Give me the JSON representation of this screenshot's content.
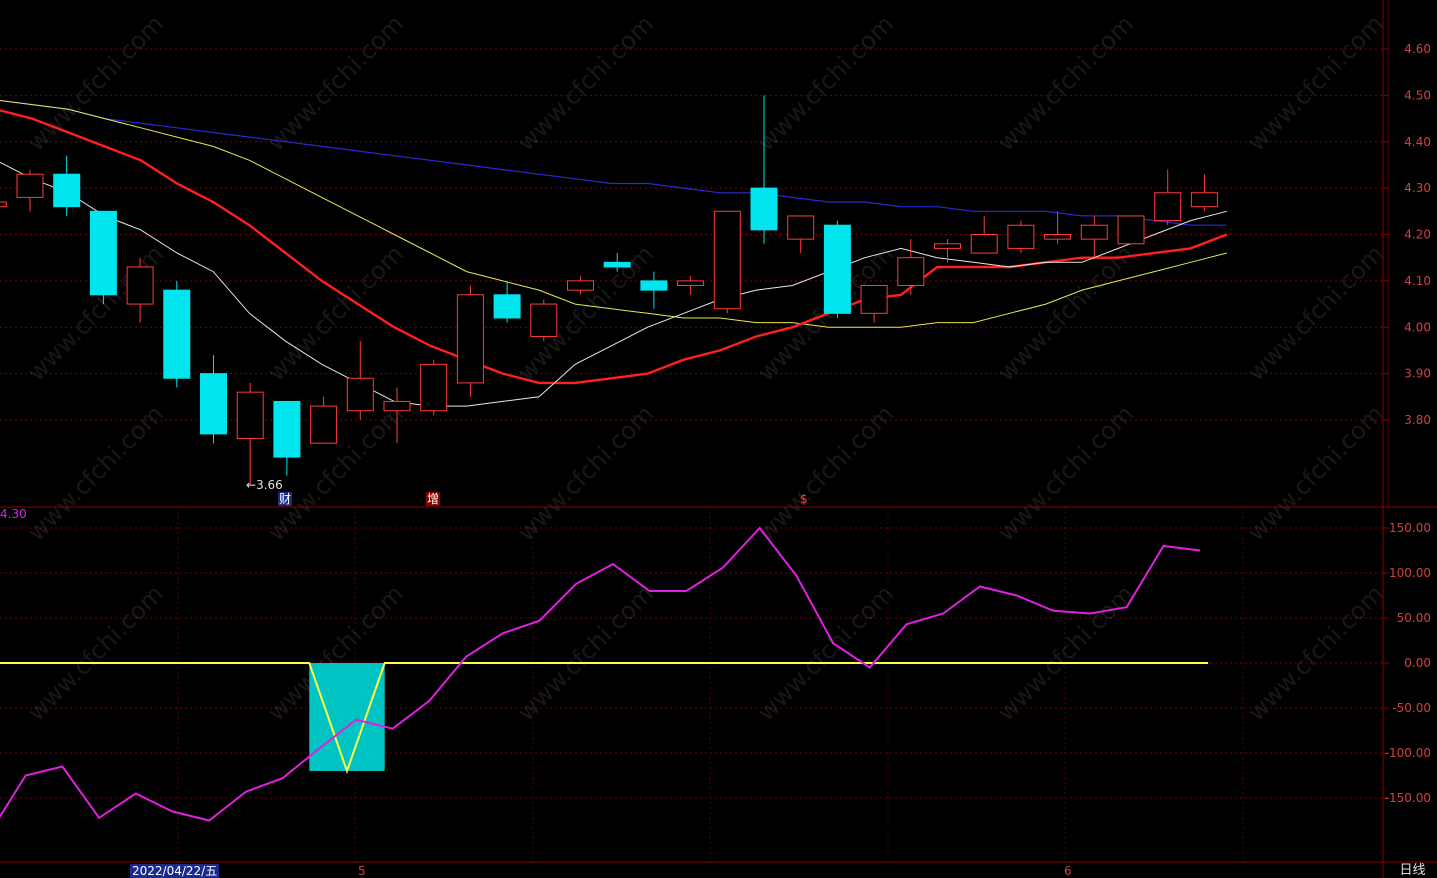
{
  "colors": {
    "background": "#000000",
    "up_candle": "#ff3a3a",
    "down_candle": "#00e5ee",
    "ma5": "#e8e8e8",
    "ma10": "#ff1f1f",
    "ma20": "#e8e850",
    "ma60": "#2a2ad0",
    "indicator_line": "#e020e0",
    "signal_line": "#ffff40",
    "signal_fill": "#00c4c4",
    "axis": "#8b0000",
    "axis_text": "#d04040"
  },
  "price_axis": {
    "ticks": [
      "4.60",
      "4.50",
      "4.40",
      "4.30",
      "4.20",
      "4.10",
      "4.00",
      "3.90",
      "3.80"
    ],
    "range": [
      3.7,
      4.7
    ]
  },
  "indicator_axis": {
    "ticks": [
      "150.00",
      "100.00",
      "50.00",
      "0.00",
      "-50.00",
      "-100.00",
      "-150.00"
    ],
    "range": [
      -190,
      160
    ]
  },
  "indicator_current_value": "4.30",
  "low_marker": "3.66",
  "event_markers": [
    {
      "label": "财",
      "color": "#ffffff",
      "bg": "#1a2a8a"
    },
    {
      "label": "增",
      "color": "#ffffff",
      "bg": "#8b0000"
    },
    {
      "label": "$",
      "color": "#ff4040",
      "bg": ""
    }
  ],
  "date_label": "2022/04/22/五",
  "month_labels": [
    "5",
    "6"
  ],
  "period_label": "日线",
  "watermark": "www.cfchi.com",
  "chart_data": {
    "type": "candlestick",
    "candles": [
      {
        "o": 4.26,
        "h": 4.28,
        "l": 4.24,
        "c": 4.27
      },
      {
        "o": 4.28,
        "h": 4.34,
        "l": 4.25,
        "c": 4.33
      },
      {
        "o": 4.33,
        "h": 4.37,
        "l": 4.24,
        "c": 4.26
      },
      {
        "o": 4.25,
        "h": 4.25,
        "l": 4.05,
        "c": 4.07
      },
      {
        "o": 4.05,
        "h": 4.15,
        "l": 4.01,
        "c": 4.13
      },
      {
        "o": 4.08,
        "h": 4.1,
        "l": 3.87,
        "c": 3.89
      },
      {
        "o": 3.9,
        "h": 3.94,
        "l": 3.75,
        "c": 3.77
      },
      {
        "o": 3.76,
        "h": 3.88,
        "l": 3.66,
        "c": 3.86
      },
      {
        "o": 3.84,
        "h": 3.84,
        "l": 3.68,
        "c": 3.72
      },
      {
        "o": 3.75,
        "h": 3.85,
        "l": 3.75,
        "c": 3.83
      },
      {
        "o": 3.82,
        "h": 3.97,
        "l": 3.8,
        "c": 3.89
      },
      {
        "o": 3.82,
        "h": 3.87,
        "l": 3.75,
        "c": 3.84
      },
      {
        "o": 3.82,
        "h": 3.93,
        "l": 3.81,
        "c": 3.92
      },
      {
        "o": 3.88,
        "h": 4.09,
        "l": 3.85,
        "c": 4.07
      },
      {
        "o": 4.07,
        "h": 4.1,
        "l": 4.01,
        "c": 4.02
      },
      {
        "o": 3.98,
        "h": 4.06,
        "l": 3.97,
        "c": 4.05
      },
      {
        "o": 4.08,
        "h": 4.11,
        "l": 4.07,
        "c": 4.1
      },
      {
        "o": 4.14,
        "h": 4.16,
        "l": 4.12,
        "c": 4.13
      },
      {
        "o": 4.1,
        "h": 4.12,
        "l": 4.04,
        "c": 4.08
      },
      {
        "o": 4.09,
        "h": 4.11,
        "l": 4.07,
        "c": 4.1
      },
      {
        "o": 4.04,
        "h": 4.25,
        "l": 4.03,
        "c": 4.25
      },
      {
        "o": 4.3,
        "h": 4.5,
        "l": 4.18,
        "c": 4.21
      },
      {
        "o": 4.19,
        "h": 4.24,
        "l": 4.16,
        "c": 4.24
      },
      {
        "o": 4.22,
        "h": 4.23,
        "l": 4.02,
        "c": 4.03
      },
      {
        "o": 4.03,
        "h": 4.09,
        "l": 4.01,
        "c": 4.09
      },
      {
        "o": 4.09,
        "h": 4.19,
        "l": 4.07,
        "c": 4.15
      },
      {
        "o": 4.17,
        "h": 4.19,
        "l": 4.14,
        "c": 4.18
      },
      {
        "o": 4.16,
        "h": 4.24,
        "l": 4.16,
        "c": 4.2
      },
      {
        "o": 4.17,
        "h": 4.23,
        "l": 4.16,
        "c": 4.22
      },
      {
        "o": 4.19,
        "h": 4.25,
        "l": 4.18,
        "c": 4.2
      },
      {
        "o": 4.19,
        "h": 4.24,
        "l": 4.15,
        "c": 4.22
      },
      {
        "o": 4.18,
        "h": 4.24,
        "l": 4.18,
        "c": 4.24
      },
      {
        "o": 4.23,
        "h": 4.34,
        "l": 4.22,
        "c": 4.29
      },
      {
        "o": 4.26,
        "h": 4.33,
        "l": 4.25,
        "c": 4.29
      }
    ],
    "ma5": [
      4.36,
      4.32,
      4.29,
      4.24,
      4.21,
      4.16,
      4.12,
      4.03,
      3.97,
      3.92,
      3.88,
      3.84,
      3.83,
      3.83,
      3.84,
      3.85,
      3.92,
      3.96,
      4.0,
      4.03,
      4.06,
      4.08,
      4.09,
      4.12,
      4.15,
      4.17,
      4.15,
      4.14,
      4.13,
      4.14,
      4.14,
      4.17,
      4.2,
      4.23,
      4.25
    ],
    "ma10": [
      4.47,
      4.45,
      4.42,
      4.39,
      4.36,
      4.31,
      4.27,
      4.22,
      4.16,
      4.1,
      4.05,
      4.0,
      3.96,
      3.93,
      3.9,
      3.88,
      3.88,
      3.89,
      3.9,
      3.93,
      3.95,
      3.98,
      4.0,
      4.03,
      4.06,
      4.07,
      4.13,
      4.13,
      4.13,
      4.14,
      4.15,
      4.15,
      4.16,
      4.17,
      4.2
    ],
    "ma20": [
      4.49,
      4.48,
      4.47,
      4.45,
      4.43,
      4.41,
      4.39,
      4.36,
      4.32,
      4.28,
      4.24,
      4.2,
      4.16,
      4.12,
      4.1,
      4.08,
      4.05,
      4.04,
      4.03,
      4.02,
      4.02,
      4.01,
      4.01,
      4.0,
      4.0,
      4.0,
      4.01,
      4.01,
      4.03,
      4.05,
      4.08,
      4.1,
      4.12,
      4.14,
      4.16
    ],
    "ma60": [
      4.49,
      4.48,
      4.47,
      4.45,
      4.44,
      4.43,
      4.42,
      4.41,
      4.4,
      4.39,
      4.38,
      4.37,
      4.36,
      4.35,
      4.34,
      4.33,
      4.32,
      4.31,
      4.31,
      4.3,
      4.29,
      4.29,
      4.28,
      4.27,
      4.27,
      4.26,
      4.26,
      4.25,
      4.25,
      4.25,
      4.24,
      4.24,
      4.23,
      4.22,
      4.22
    ],
    "indicator": [
      -190,
      -125,
      -115,
      -172,
      -145,
      -165,
      -175,
      -143,
      -128,
      -95,
      -63,
      -73,
      -42,
      7,
      33,
      47,
      88,
      110,
      80,
      80,
      106,
      150,
      97,
      22,
      -5,
      43,
      55,
      85,
      75,
      58,
      55,
      62,
      130,
      125
    ],
    "signal": [
      0,
      0,
      0,
      0,
      0,
      0,
      0,
      0,
      0,
      0,
      0,
      0,
      0,
      0,
      0,
      0,
      0,
      0,
      0,
      0,
      0,
      0,
      0,
      0,
      0,
      0,
      0,
      0,
      0,
      0,
      0,
      0,
      0,
      0
    ],
    "signal_dip": {
      "start_index": 8.7,
      "end_index": 10.7,
      "low_index": 9.7,
      "low_value": -120
    }
  }
}
